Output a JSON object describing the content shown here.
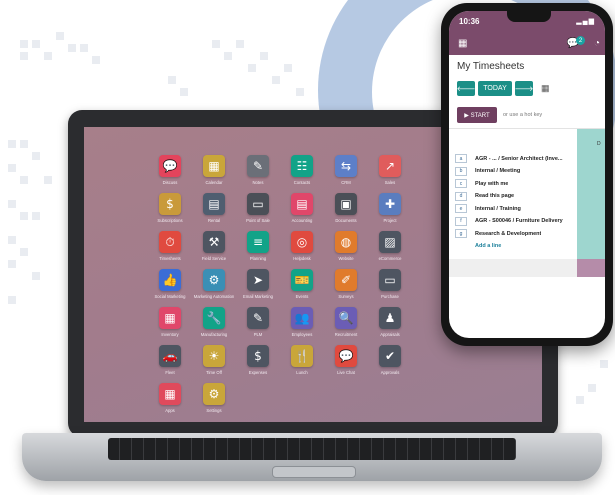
{
  "desktop": {
    "apps": [
      {
        "label": "Discuss",
        "icon": "chat-bubble-icon",
        "glyph": "💬",
        "color": "#e3445c"
      },
      {
        "label": "Calendar",
        "icon": "calendar-icon",
        "glyph": "▦",
        "color": "#c9a63a"
      },
      {
        "label": "Notes",
        "icon": "note-icon",
        "glyph": "✎",
        "color": "#6b6f78"
      },
      {
        "label": "Contacts",
        "icon": "contact-card-icon",
        "glyph": "☷",
        "color": "#12a388"
      },
      {
        "label": "CRM",
        "icon": "handshake-icon",
        "glyph": "⇆",
        "color": "#5d7fc8"
      },
      {
        "label": "Sales",
        "icon": "chart-up-icon",
        "glyph": "↗",
        "color": "#e05c5c"
      },
      {
        "label": "Subscriptions",
        "icon": "dollar-icon",
        "glyph": "$",
        "color": "#c99a3a"
      },
      {
        "label": "Rental",
        "icon": "rental-icon",
        "glyph": "▤",
        "color": "#4f5e70"
      },
      {
        "label": "Point of Sale",
        "icon": "pos-icon",
        "glyph": "▭",
        "color": "#4b4f57"
      },
      {
        "label": "Accounting",
        "icon": "document-icon",
        "glyph": "▤",
        "color": "#e0476a"
      },
      {
        "label": "Documents",
        "icon": "folder-icon",
        "glyph": "▣",
        "color": "#4b4f57"
      },
      {
        "label": "Project",
        "icon": "puzzle-icon",
        "glyph": "✚",
        "color": "#5a7dbf"
      },
      {
        "label": "Timesheets",
        "icon": "stopwatch-icon",
        "glyph": "⏱",
        "color": "#e04a3f"
      },
      {
        "label": "Field Service",
        "icon": "worker-icon",
        "glyph": "⚒",
        "color": "#4e5561"
      },
      {
        "label": "Planning",
        "icon": "planning-icon",
        "glyph": "≡",
        "color": "#12a388"
      },
      {
        "label": "Helpdesk",
        "icon": "lifebuoy-icon",
        "glyph": "◎",
        "color": "#e04a3f"
      },
      {
        "label": "Website",
        "icon": "globe-icon",
        "glyph": "◍",
        "color": "#e07b2c"
      },
      {
        "label": "eCommerce",
        "icon": "image-icon",
        "glyph": "▨",
        "color": "#4e5561"
      },
      {
        "label": "Social Marketing",
        "icon": "thumbs-up-icon",
        "glyph": "👍",
        "color": "#3b6dd6"
      },
      {
        "label": "Marketing Automation",
        "icon": "gear-icon",
        "glyph": "⚙",
        "color": "#3a8fb5"
      },
      {
        "label": "Email Marketing",
        "icon": "paper-plane-icon",
        "glyph": "➤",
        "color": "#4e5561"
      },
      {
        "label": "Events",
        "icon": "ticket-icon",
        "glyph": "🎫",
        "color": "#12a388"
      },
      {
        "label": "Surveys",
        "icon": "clipboard-icon",
        "glyph": "✐",
        "color": "#e07b2c"
      },
      {
        "label": "Purchase",
        "icon": "credit-card-icon",
        "glyph": "▭",
        "color": "#4e5561"
      },
      {
        "label": "Inventory",
        "icon": "box-icon",
        "glyph": "▦",
        "color": "#e0476a"
      },
      {
        "label": "Manufacturing",
        "icon": "wrench-icon",
        "glyph": "🔧",
        "color": "#12a388"
      },
      {
        "label": "PLM",
        "icon": "plm-icon",
        "glyph": "✎",
        "color": "#4e5561"
      },
      {
        "label": "Employees",
        "icon": "people-icon",
        "glyph": "👥",
        "color": "#6b5db5"
      },
      {
        "label": "Recruitment",
        "icon": "magnifier-user-icon",
        "glyph": "🔍",
        "color": "#6b5db5"
      },
      {
        "label": "Appraisals",
        "icon": "appraisal-icon",
        "glyph": "♟",
        "color": "#4e5561"
      },
      {
        "label": "Fleet",
        "icon": "car-icon",
        "glyph": "🚗",
        "color": "#4e5561"
      },
      {
        "label": "Time Off",
        "icon": "time-off-icon",
        "glyph": "☀",
        "color": "#c9a63a"
      },
      {
        "label": "Expenses",
        "icon": "expenses-icon",
        "glyph": "$",
        "color": "#4e5561"
      },
      {
        "label": "Lunch",
        "icon": "cutlery-icon",
        "glyph": "🍴",
        "color": "#c9a63a"
      },
      {
        "label": "Live Chat",
        "icon": "speech-icon",
        "glyph": "💬",
        "color": "#e04a3f"
      },
      {
        "label": "Approvals",
        "icon": "approval-icon",
        "glyph": "✔",
        "color": "#4e5561"
      },
      {
        "label": "Apps",
        "icon": "apps-icon",
        "glyph": "▦",
        "color": "#e04a5c"
      },
      {
        "label": "Settings",
        "icon": "gear-icon",
        "glyph": "⚙",
        "color": "#c9a63a"
      }
    ]
  },
  "phone": {
    "status_time": "10:36",
    "signal": "▂▄▆",
    "chat_badge": "2",
    "title": "My Timesheets",
    "prev_label": "🡐",
    "today_label": "TODAY",
    "next_label": "🡒",
    "start_label": "▶ START",
    "hotkey_text": "or use a hot key",
    "edge_letter": "D",
    "rows": [
      {
        "key": "a",
        "text": "AGR - ... / Senior Architect (Inve..."
      },
      {
        "key": "b",
        "text": "Internal / Meeting"
      },
      {
        "key": "c",
        "text": "Play with me"
      },
      {
        "key": "d",
        "text": "Read this page"
      },
      {
        "key": "e",
        "text": "Internal / Training"
      },
      {
        "key": "f",
        "text": "AGR - S00046 / Furniture Delivery"
      },
      {
        "key": "g",
        "text": "Research & Development"
      }
    ],
    "add_line": "Add a line"
  }
}
